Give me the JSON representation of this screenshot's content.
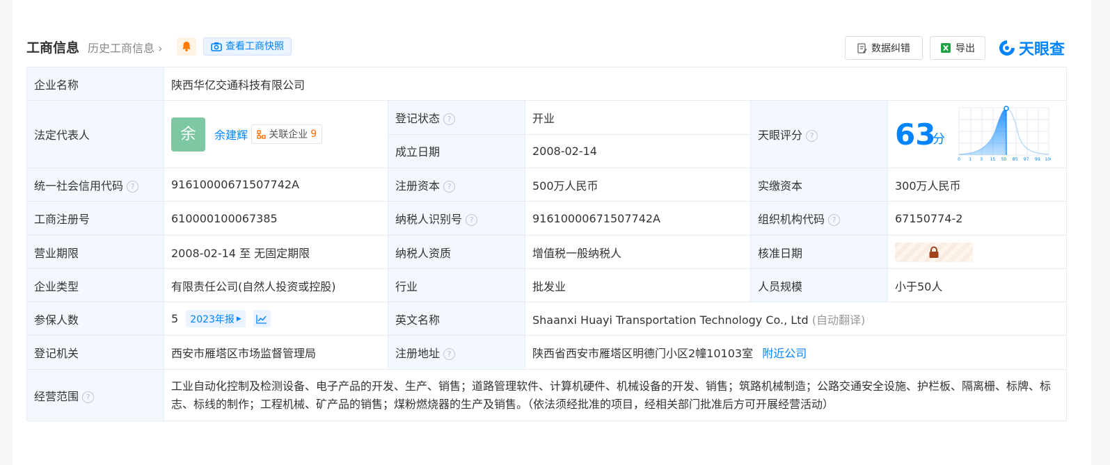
{
  "header": {
    "title": "工商信息",
    "history_link": "历史工商信息",
    "snapshot_button": "查看工商快照",
    "error_button": "数据纠错",
    "export_button": "导出",
    "brand": "天眼查"
  },
  "labels": {
    "company_name": "企业名称",
    "legal_rep": "法定代表人",
    "reg_status": "登记状态",
    "found_date": "成立日期",
    "tianyan_score": "天眼评分",
    "credit_code": "统一社会信用代码",
    "reg_capital": "注册资本",
    "paid_capital": "实缴资本",
    "biz_reg_no": "工商注册号",
    "taxpayer_id": "纳税人识别号",
    "org_code": "组织机构代码",
    "biz_term": "营业期限",
    "taxpayer_qual": "纳税人资质",
    "approval_date": "核准日期",
    "company_type": "企业类型",
    "industry": "行业",
    "staff_size": "人员规模",
    "insured": "参保人数",
    "english_name": "英文名称",
    "reg_authority": "登记机关",
    "reg_address": "注册地址",
    "biz_scope": "经营范围"
  },
  "values": {
    "company_name": "陕西华亿交通科技有限公司",
    "legal_rep_avatar": "余",
    "legal_rep_name": "余建辉",
    "related_label": "关联企业",
    "related_count": "9",
    "reg_status": "开业",
    "found_date": "2008-02-14",
    "score": "63",
    "score_unit": "分",
    "credit_code": "91610000671507742A",
    "reg_capital": "500万人民币",
    "paid_capital": "300万人民币",
    "biz_reg_no": "610000100067385",
    "taxpayer_id": "91610000671507742A",
    "org_code": "67150774-2",
    "biz_term": "2008-02-14 至 无固定期限",
    "taxpayer_qual": "增值税一般纳税人",
    "company_type": "有限责任公司(自然人投资或控股)",
    "industry": "批发业",
    "staff_size": "小于50人",
    "insured": "5",
    "report_year": "2023年报",
    "english_name": "Shaanxi Huayi Transportation Technology Co., Ltd",
    "auto_translate": "(自动翻译)",
    "reg_authority": "西安市雁塔区市场监督管理局",
    "reg_address": "陕西省西安市雁塔区明德门小区2幢10103室",
    "nearby_link": "附近公司",
    "biz_scope": "工业自动化控制及检测设备、电子产品的开发、生产、销售；道路管理软件、计算机硬件、机械设备的开发、销售；筑路机械制造；公路交通安全设施、护栏板、隔离栅、标牌、标志、标线的制作；工程机械、矿产品的销售；煤粉燃烧器的生产及销售。（依法须经批准的项目，经相关部门批准后方可开展经营活动）"
  },
  "score_chart": {
    "x_ticks": [
      "0",
      "1",
      "3",
      "15",
      "50",
      "85",
      "97",
      "99",
      "100"
    ],
    "accent": "#0084ff"
  },
  "colors": {
    "accent": "#0084ff",
    "status_green": "#21a249"
  }
}
